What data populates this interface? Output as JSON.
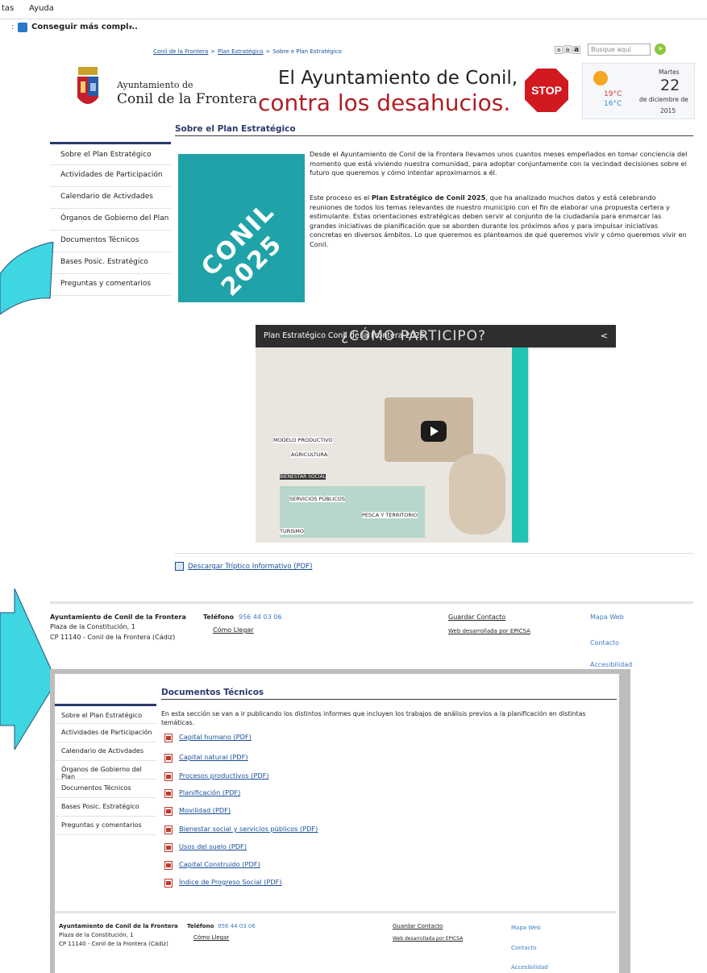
{
  "browser": {
    "menu_1": "tas",
    "menu_2": "Ayuda",
    "fav_label": "Conseguir más compl...",
    "fav_caret": "▾"
  },
  "breadcrumb": {
    "crumb_1": "Conil de la Frontera",
    "sep": ">",
    "crumb_2": "Plan Estratégico",
    "crumb_3": "Sobre e Plan Estratégico"
  },
  "font_sizes": [
    "a",
    "a",
    "a"
  ],
  "search": {
    "placeholder": "Busque aquí",
    "go": "»"
  },
  "logo": {
    "line1": "Ayuntamiento de",
    "line2": "Conil de la Frontera"
  },
  "banner": {
    "line1": "El Ayuntamiento de Conil,",
    "line2": "contra los desahucios.",
    "stop": "STOP"
  },
  "weather": {
    "weekday": "Martes",
    "day": "22",
    "month": "de diciembre de",
    "year": "2015",
    "hi": "19°C",
    "lo": "16°C"
  },
  "nav": [
    "Sobre el Plan Estratégico",
    "Actividades de Participación",
    "Calendario de Activdades",
    "Órganos de Gobierno del Plan",
    "Documentos Técnicos",
    "Bases Posic. Estratégico",
    "Preguntas y comentarios"
  ],
  "page1": {
    "title": "Sobre el Plan Estratégico",
    "logo_text": "CONIL 2025",
    "p1": "Desde el Ayuntamiento de Conil de la Frontera llevamos unos cuantos meses empeñados en tomar conciencia del momento que está viviendo nuestra comunidad, para adoptar conjuntamente con la vecindad decisiones sobre el futuro que queremos y cómo intentar aproximarnos a él.",
    "p2_a": "Este proceso es el ",
    "p2_b": "Plan Estratégico de Conil 2025",
    "p2_c": ", que ha analizado muchos datos y está celebrando reuniones de todos los temas relevantes de nuestro municipio con el fin de elaborar una propuesta certera y estimulante. Estas orientaciones estratégicas deben servir al conjunto de la ciudadanía para enmarcar las grandes iniciativas de planificación que se aborden durante los próximos años y para impulsar iniciativas concretas en diversos ámbitos. Lo que queremos es planteamos de qué queremos vivir y cómo queremos vivir en Conil.",
    "video_title": "Plan Estratégico Conil de la Frontera 2025",
    "video_overlay": "¿CÓMO PARTICIPO?",
    "video_labels": [
      "MODELO PRODUCTIVO",
      "AGRICULTURA",
      "BIENESTAR SOCIAL",
      "SERVICIOS PÚBLICOS",
      "PESCA Y TERRITORIO",
      "TURISMO"
    ],
    "download": "Descargar Tríptico Informativo (PDF)"
  },
  "footer": {
    "org": "Ayuntamiento de Conil de la Frontera",
    "addr1": "Plaza de la Constitución, 1",
    "addr2": "CP 11140 - Conil de la Frontera (Cádiz)",
    "tel_label": "Teléfono",
    "tel": "956 44 03 06",
    "como": "Cómo Llegar",
    "guardar": "Guardar Contacto",
    "web": "Web desarrollada por EPICSA",
    "mapa": "Mapa Web",
    "contacto": "Contacto",
    "accesibilidad": "Accesibilidad"
  },
  "page2": {
    "title": "Documentos Técnicos",
    "intro": "En esta sección se van a ir publicando los distintos informes que incluyen los trabajos de análisis previos a la planificación en distintas temáticas.",
    "docs": [
      "Capital humano (PDF)",
      "Capital natural (PDF)",
      "Procesos productivos (PDF)",
      "Planificación (PDF)",
      "Movilidad (PDF)",
      "Bienestar social y servicios públicos (PDF)",
      "Usos del suelo (PDF)",
      "Capital Construido (PDF)",
      "Índice de Progreso Social (PDF)"
    ]
  },
  "colors": {
    "teal": "#1fa3a8",
    "navy": "#2b3a6e",
    "arrow": "#3ed6e0",
    "red": "#b01e23"
  }
}
